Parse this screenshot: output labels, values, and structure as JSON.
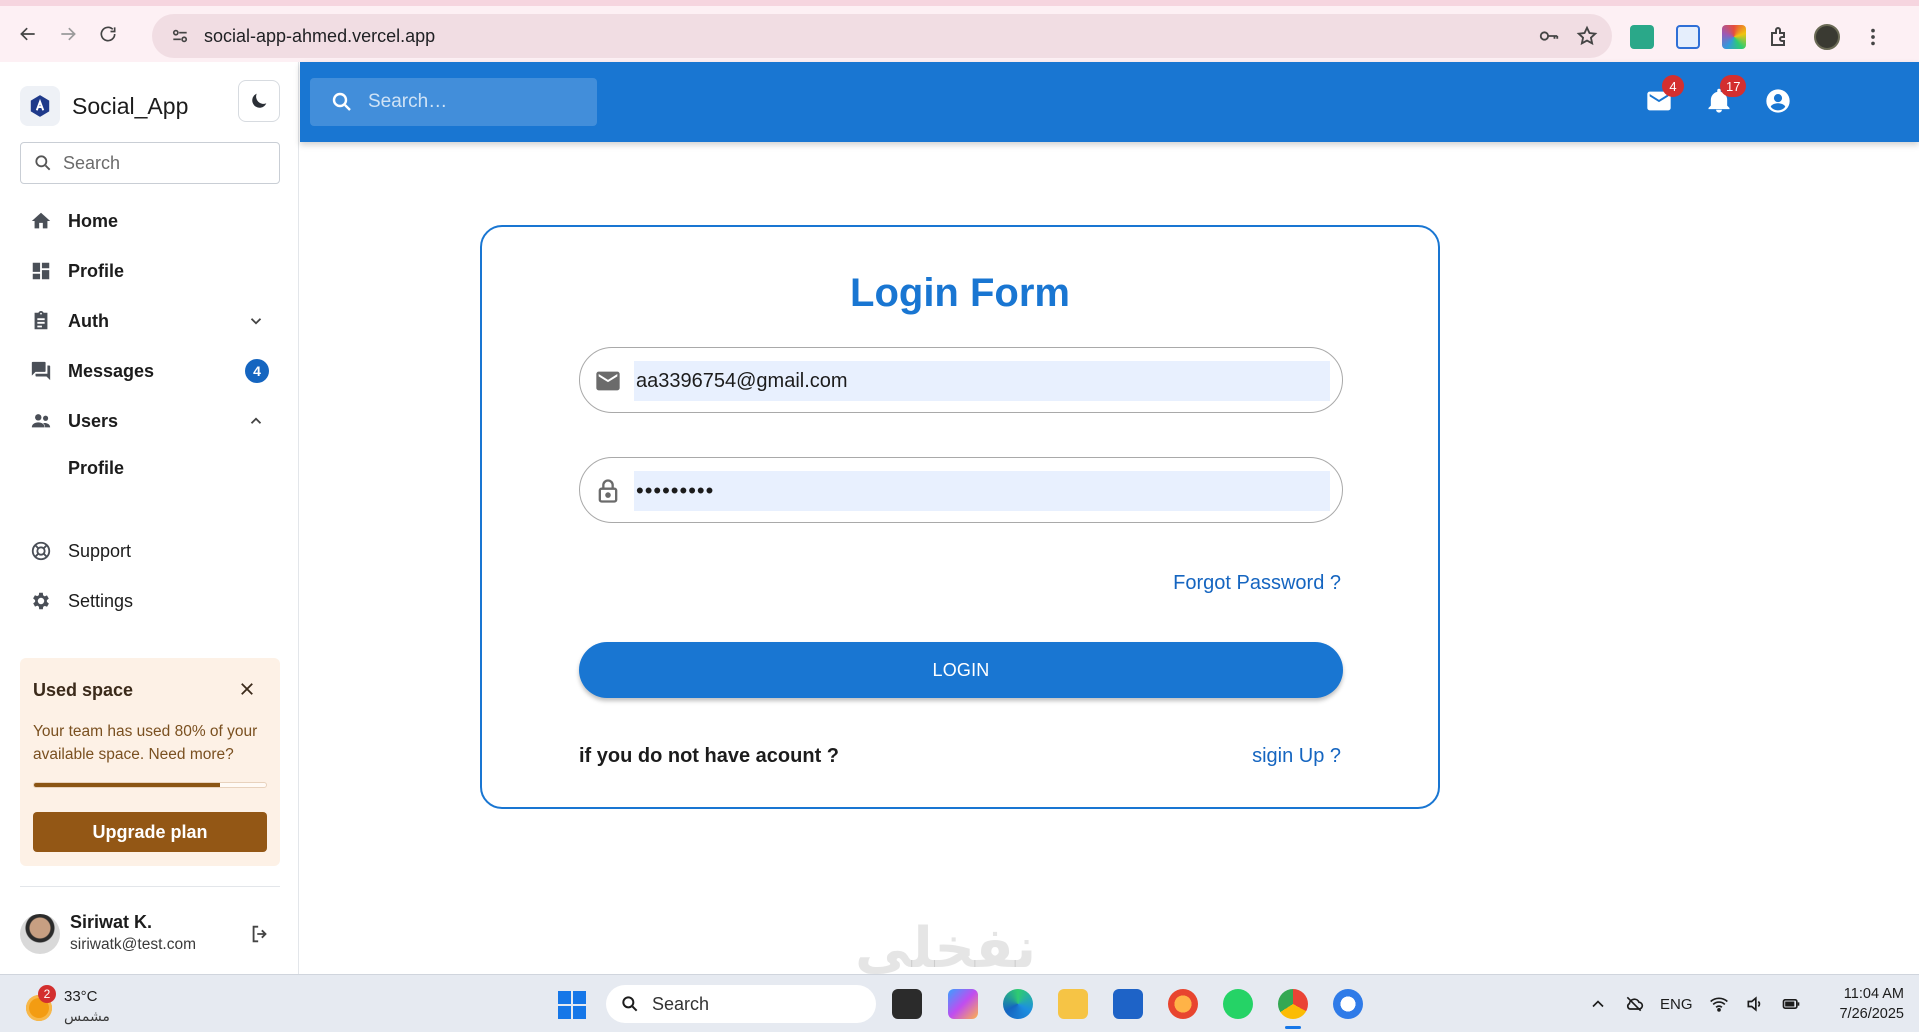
{
  "browser": {
    "url": "social-app-ahmed.vercel.app"
  },
  "sidebar": {
    "brand": "Social_App",
    "search_placeholder": "Search",
    "items": [
      {
        "label": "Home",
        "icon": "home-icon"
      },
      {
        "label": "Profile",
        "icon": "dashboard-icon"
      },
      {
        "label": "Auth",
        "icon": "clipboard-icon"
      },
      {
        "label": "Messages",
        "icon": "forum-icon",
        "count": "4"
      },
      {
        "label": "Users",
        "icon": "people-icon"
      }
    ],
    "users_sub": [
      "Profile"
    ],
    "bottom_items": [
      {
        "label": "Support",
        "icon": "support-icon"
      },
      {
        "label": "Settings",
        "icon": "gear-icon"
      }
    ],
    "usage": {
      "title": "Used space",
      "text": "Your team has used 80% of your available space. Need more?",
      "percent": 80,
      "button": "Upgrade plan"
    },
    "user": {
      "name": "Siriwat K.",
      "email": "siriwatk@test.com"
    }
  },
  "header": {
    "search_placeholder": "Search…",
    "mail_count": "4",
    "notification_count": "17"
  },
  "login": {
    "title": "Login Form",
    "email_value": "aa3396754@gmail.com",
    "password_value": "•••••••••",
    "forgot": "Forgot Password ?",
    "button": "LOGIN",
    "no_account": "if you do not have acount ?",
    "signup": "sigin Up ?"
  },
  "watermark": "نفخلي",
  "taskbar": {
    "weather_temp": "33°C",
    "weather_desc": "مشمس",
    "weather_badge": "2",
    "search_label": "Search",
    "language": "ENG",
    "time": "11:04 AM",
    "date": "7/26/2025"
  },
  "colors": {
    "primary": "#1976d2",
    "usage_bg": "#fdf1e6",
    "upgrade": "#935715",
    "badge": "#d32f2f"
  }
}
